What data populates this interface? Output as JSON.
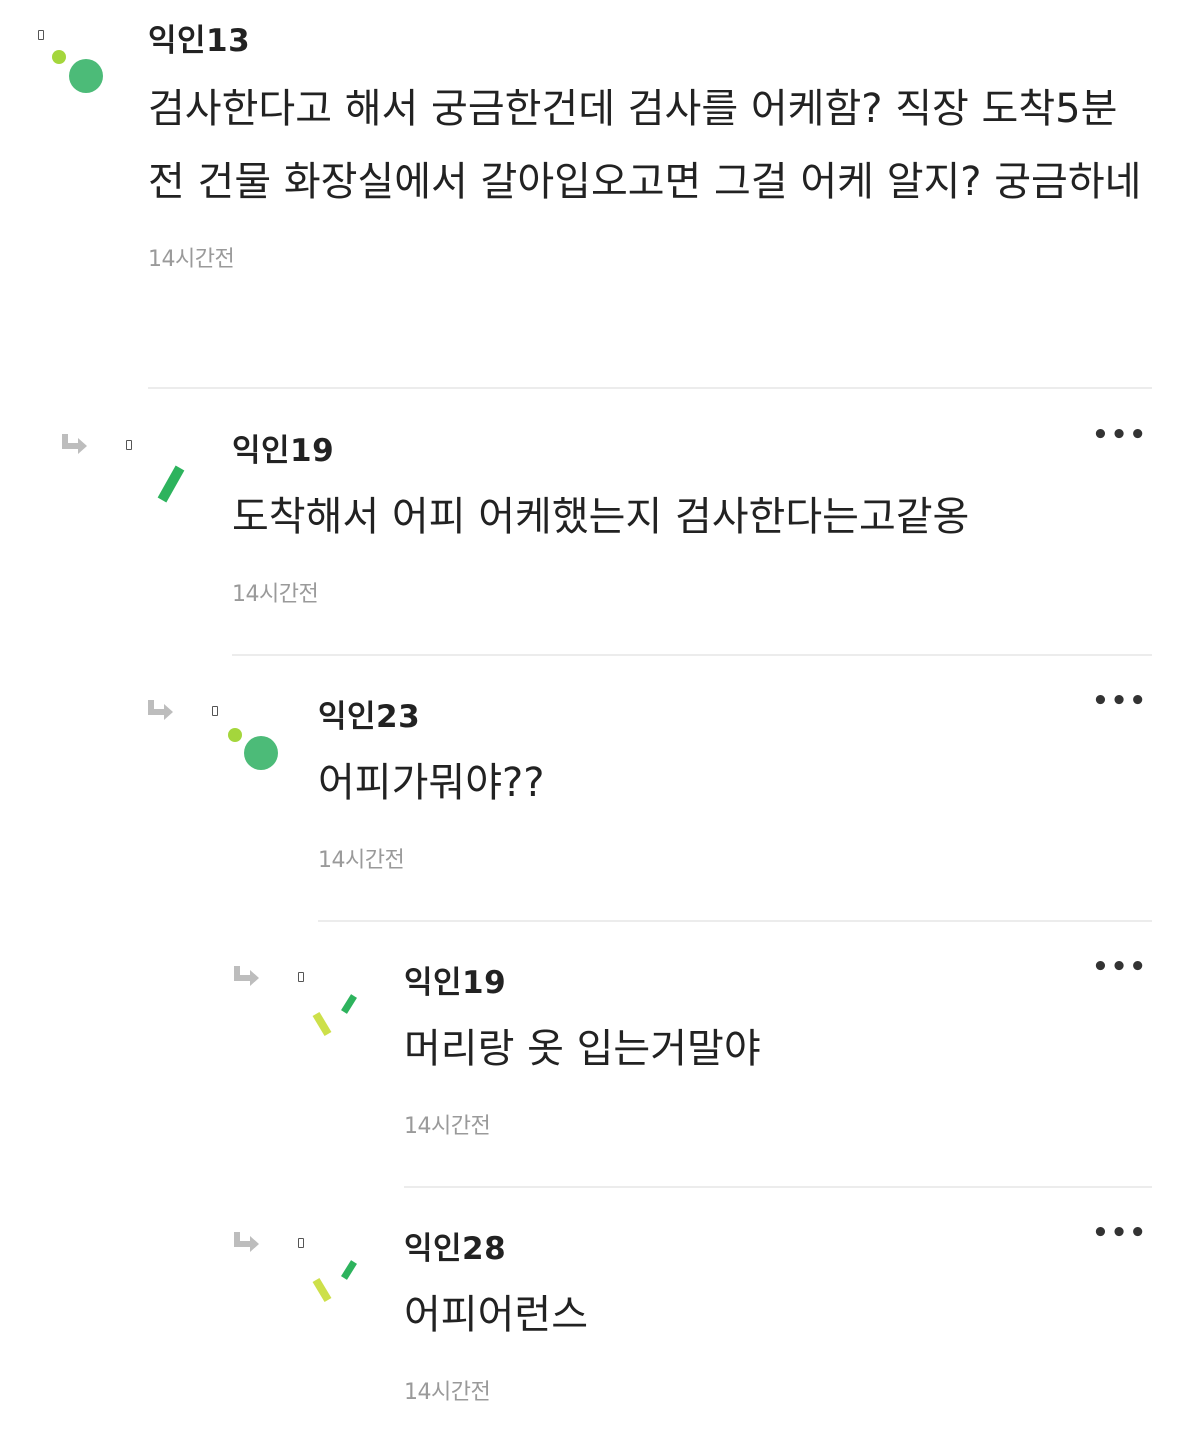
{
  "comments": [
    {
      "author": "익인13",
      "text": "검사한다고 해서 궁금한건데 검사를 어케함? 직장 도착5분 전 건물 화장실에서 갈아입오고면 그걸 어케 알지? 궁금하네",
      "time": "14시간전",
      "avatar_icon": "dots-avatar-icon"
    },
    {
      "author": "익인19",
      "text": "도착해서 어피 어케했는지 검사한다는고같옹",
      "time": "14시간전",
      "avatar_icon": "slash-avatar-icon"
    },
    {
      "author": "익인23",
      "text": "어피가뭐야??",
      "time": "14시간전",
      "avatar_icon": "dots-avatar-icon"
    },
    {
      "author": "익인19",
      "text": "머리랑 옷 입는거말야",
      "time": "14시간전",
      "avatar_icon": "double-slash-avatar-icon"
    },
    {
      "author": "익인28",
      "text": "어피어런스",
      "time": "14시간전",
      "avatar_icon": "double-slash-avatar-icon"
    }
  ],
  "more_label": "•••",
  "colors": {
    "green": "#4cbb78",
    "lime": "#a4d63c",
    "slash_green": "#2db35d",
    "yellow_green": "#cde04a"
  }
}
